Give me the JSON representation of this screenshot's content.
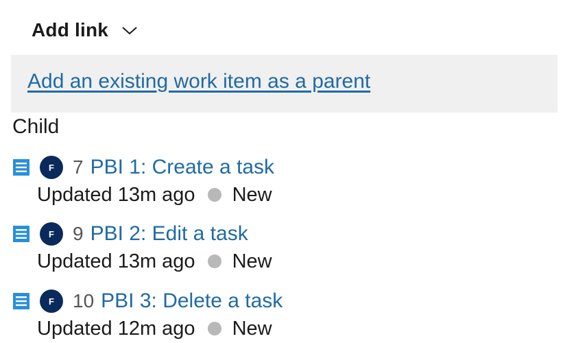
{
  "header": {
    "add_link_label": "Add link",
    "chevron_icon": "chevron-down-icon"
  },
  "parent": {
    "link_label": "Add an existing work item as a parent"
  },
  "children": {
    "group_label": "Child",
    "items": [
      {
        "id": "7",
        "title": "PBI 1: Create a task",
        "avatar_initial": "F",
        "updated": "Updated 13m ago",
        "state": "New",
        "type_icon": "backlog-item-icon"
      },
      {
        "id": "9",
        "title": "PBI 2: Edit a task",
        "avatar_initial": "F",
        "updated": "Updated 13m ago",
        "state": "New",
        "type_icon": "backlog-item-icon"
      },
      {
        "id": "10",
        "title": "PBI 3: Delete a task",
        "avatar_initial": "F",
        "updated": "Updated 12m ago",
        "state": "New",
        "type_icon": "backlog-item-icon"
      }
    ]
  },
  "colors": {
    "link": "#1f6aa5",
    "type_icon": "#2a8fd8",
    "avatar": "#0a2a5c",
    "state_new": "#b8b8b8",
    "parent_bar_bg": "#f0f0f0"
  }
}
